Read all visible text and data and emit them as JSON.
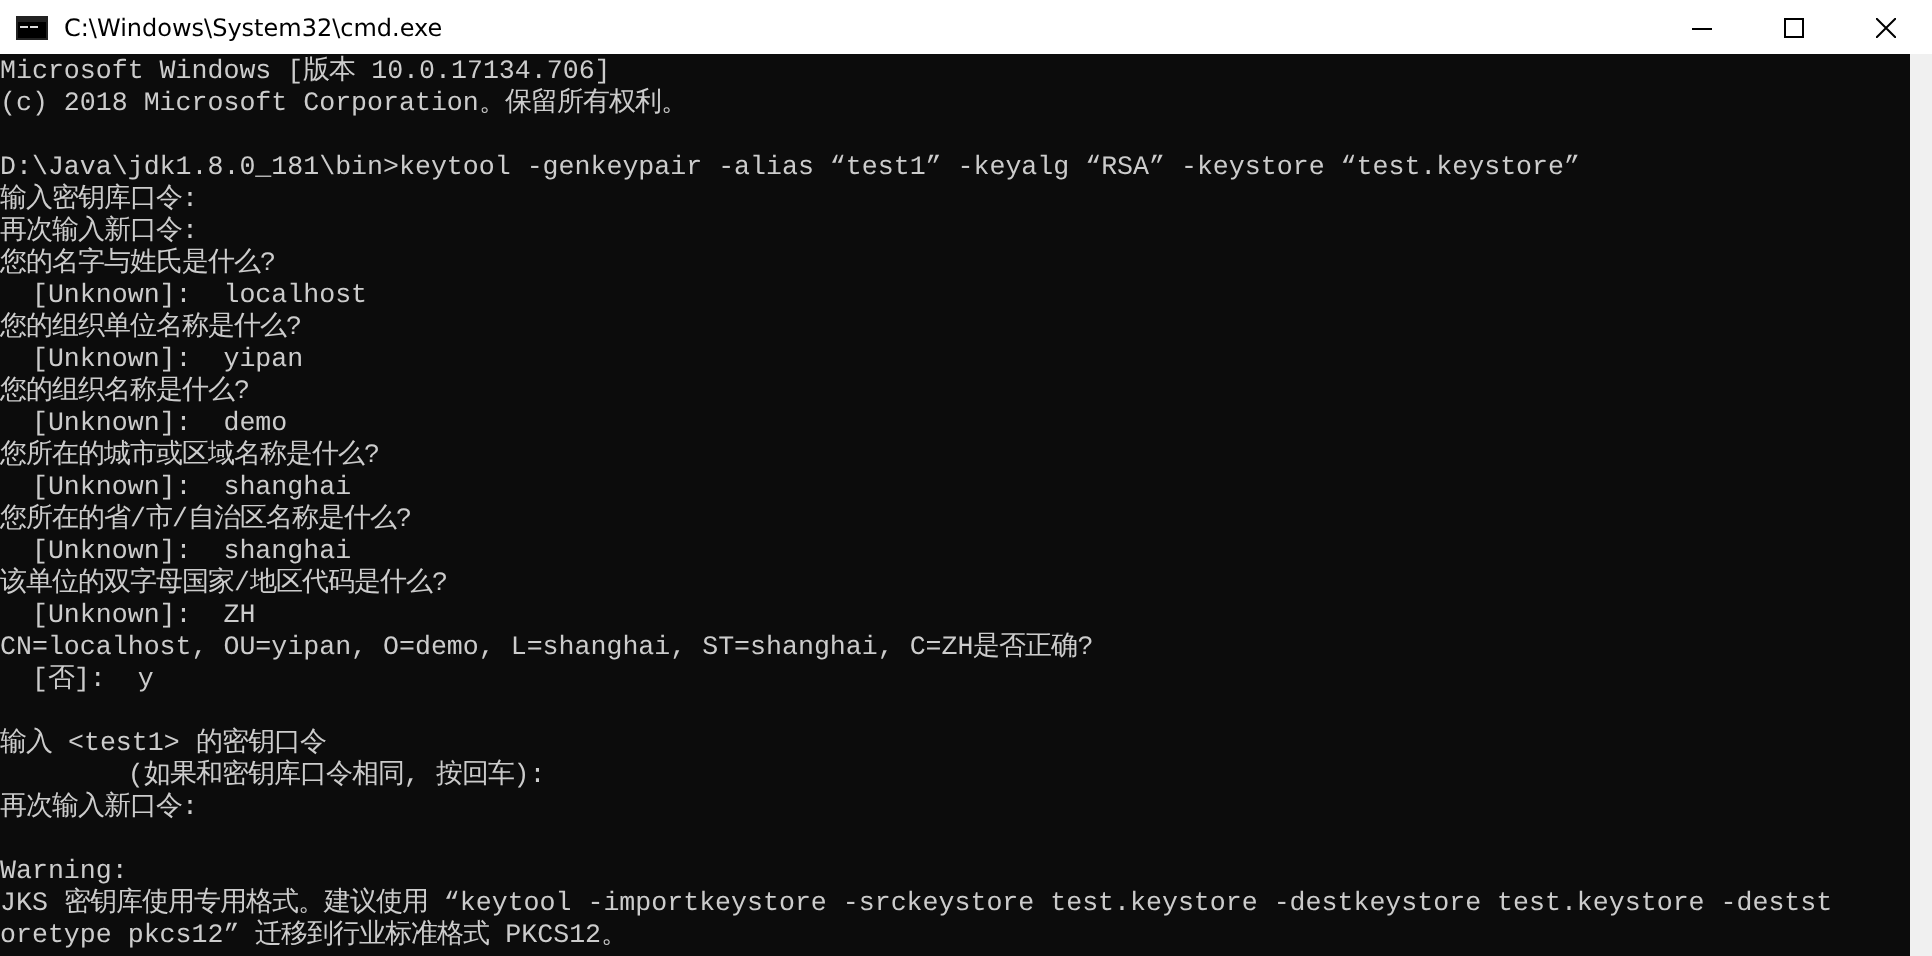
{
  "window": {
    "title": "C:\\Windows\\System32\\cmd.exe"
  },
  "console": {
    "blocks": [
      [
        "Microsoft Windows [版本 10.0.17134.706]",
        "(c) 2018 Microsoft Corporation。保留所有权利。"
      ],
      [
        "D:\\Java\\jdk1.8.0_181\\bin>keytool -genkeypair -alias “test1” -keyalg “RSA” -keystore “test.keystore”",
        "输入密钥库口令:",
        "再次输入新口令:",
        "您的名字与姓氏是什么?",
        "  [Unknown]:  localhost",
        "您的组织单位名称是什么?",
        "  [Unknown]:  yipan",
        "您的组织名称是什么?",
        "  [Unknown]:  demo",
        "您所在的城市或区域名称是什么?",
        "  [Unknown]:  shanghai",
        "您所在的省/市/自治区名称是什么?",
        "  [Unknown]:  shanghai",
        "该单位的双字母国家/地区代码是什么?",
        "  [Unknown]:  ZH",
        "CN=localhost, OU=yipan, O=demo, L=shanghai, ST=shanghai, C=ZH是否正确?",
        "  [否]:  y"
      ],
      [
        "输入 <test1> 的密钥口令",
        "        (如果和密钥库口令相同, 按回车):",
        "再次输入新口令:"
      ],
      [
        "Warning:",
        "JKS 密钥库使用专用格式。建议使用 “keytool -importkeystore -srckeystore test.keystore -destkeystore test.keystore -destst",
        "oretype pkcs12” 迁移到行业标准格式 PKCS12。"
      ]
    ]
  }
}
